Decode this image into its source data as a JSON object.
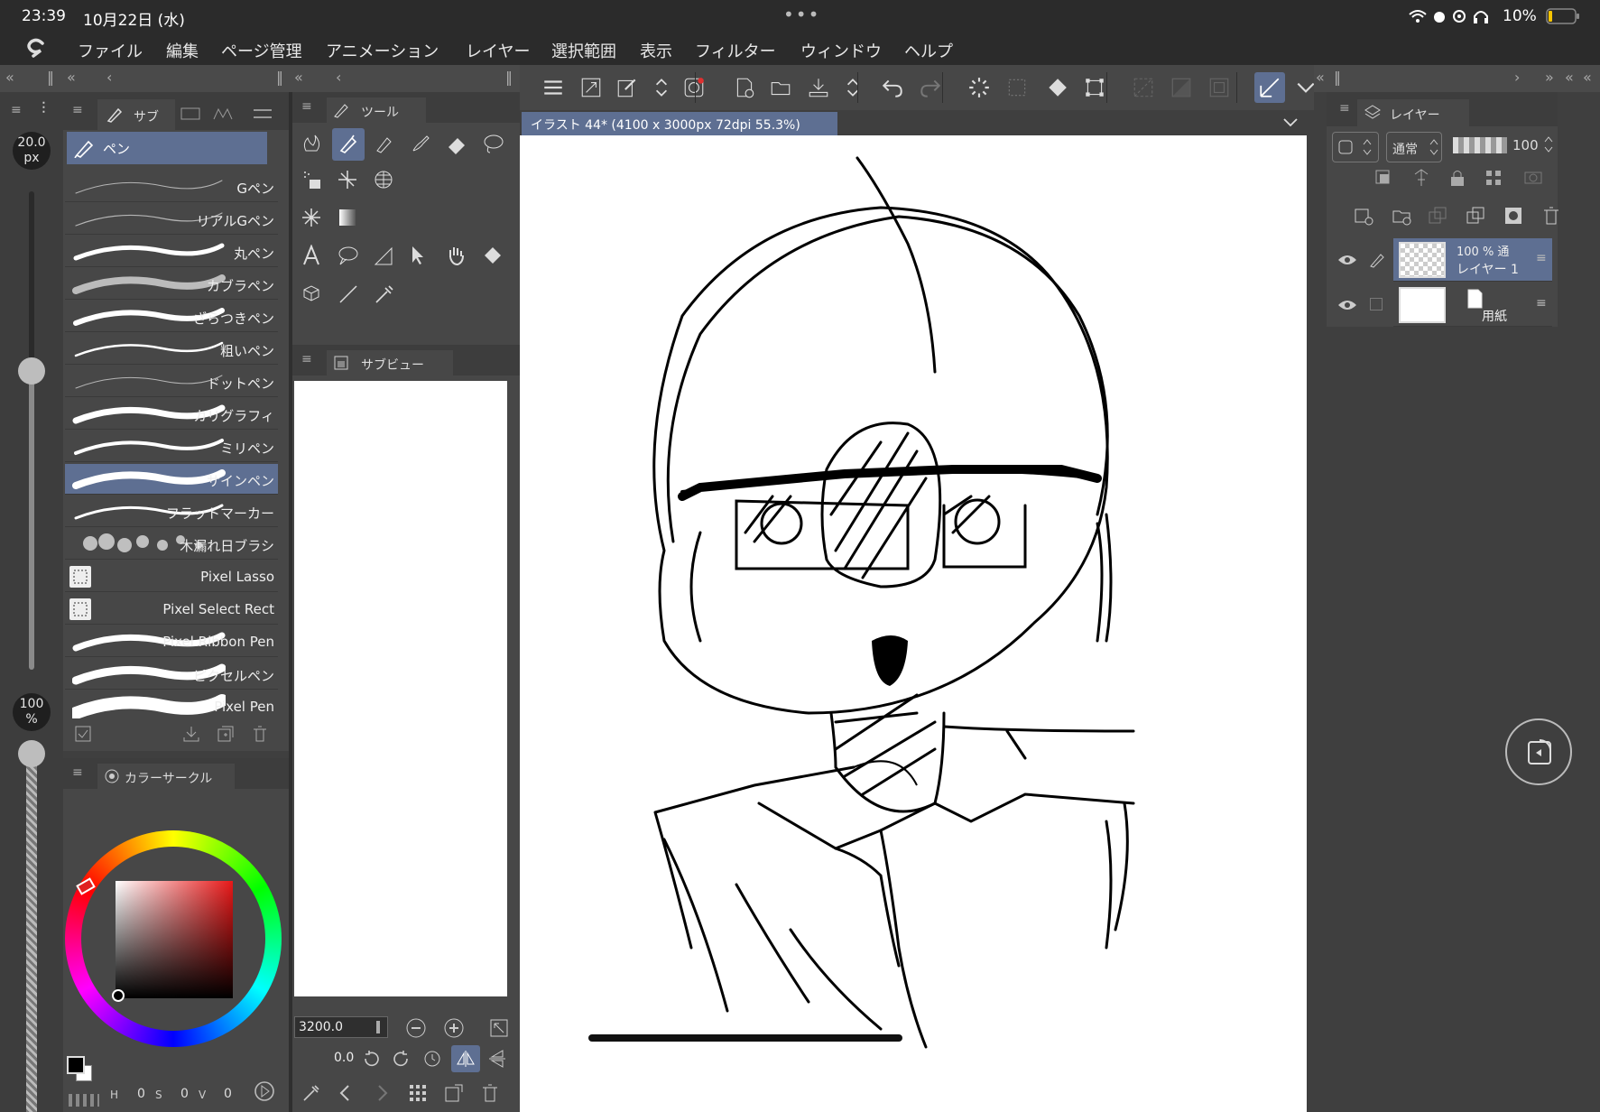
{
  "status": {
    "time": "23:39",
    "date": "10月22日 (水)",
    "battery": "10%",
    "dots": "•••"
  },
  "menu": [
    "ファイル",
    "編集",
    "ページ管理",
    "アニメーション",
    "レイヤー",
    "選択範囲",
    "表示",
    "フィルター",
    "ウィンドウ",
    "ヘルプ"
  ],
  "brush_size": {
    "value": "20.0",
    "unit": "px"
  },
  "opacity": {
    "value": "100",
    "unit": "%"
  },
  "subtool_panel": {
    "tab": "サブ",
    "group": "ペン",
    "brushes": [
      {
        "label": "Gペン",
        "selected": false
      },
      {
        "label": "リアルGペン",
        "selected": false
      },
      {
        "label": "丸ペン",
        "selected": false
      },
      {
        "label": "カブラペン",
        "selected": false
      },
      {
        "label": "ざらつきペン",
        "selected": false
      },
      {
        "label": "粗いペン",
        "selected": false
      },
      {
        "label": "ドットペン",
        "selected": false
      },
      {
        "label": "カリグラフィ",
        "selected": false
      },
      {
        "label": "ミリペン",
        "selected": false
      },
      {
        "label": "サインペン",
        "selected": true
      },
      {
        "label": "フラットマーカー",
        "selected": false
      },
      {
        "label": "木漏れ日ブラシ",
        "selected": false
      },
      {
        "label": "Pixel Lasso",
        "selected": false
      },
      {
        "label": "Pixel Select Rect",
        "selected": false
      },
      {
        "label": "Pixel Ribbon Pen",
        "selected": false
      },
      {
        "label": "ピクセルペン",
        "selected": false
      },
      {
        "label": "Pixel Pen",
        "selected": false
      }
    ]
  },
  "tool_panel": {
    "tab": "ツール"
  },
  "subview_panel": {
    "tab": "サブビュー",
    "zoom": "3200.0",
    "rotation": "0.0"
  },
  "color_panel": {
    "tab": "カラーサークル",
    "hsv_labels": [
      "H",
      "S",
      "V"
    ],
    "hsv_values": [
      "0",
      "0",
      "0"
    ],
    "main_color": "#000000",
    "sub_color": "#ffffff"
  },
  "canvas": {
    "doc_tab": "イラスト 44* (4100 x 3000px 72dpi 55.3%)"
  },
  "layer_panel": {
    "tab": "レイヤー",
    "blend_mode": "通常",
    "opacity": "100",
    "layers": [
      {
        "name": "レイヤー 1",
        "info": "100 %  通",
        "selected": true
      },
      {
        "name": "用紙",
        "info": "",
        "selected": false
      }
    ]
  }
}
